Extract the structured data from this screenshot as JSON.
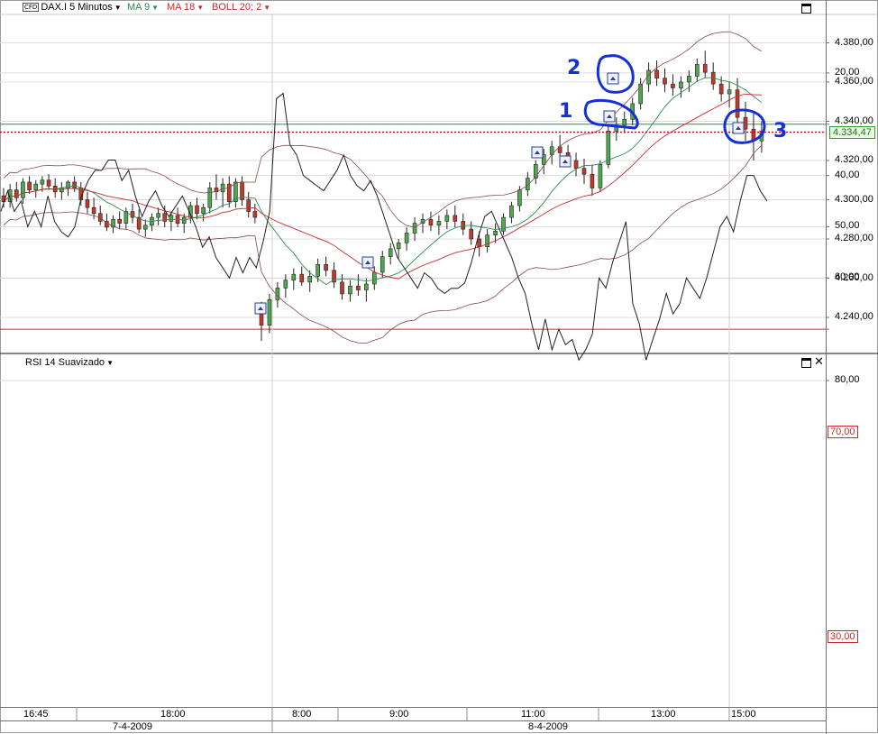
{
  "toolbar": {
    "instrument": "DAX.I 5 Minutos",
    "instrument_badge": "CFD",
    "ma9": "MA 9",
    "ma18": "MA 18",
    "boll": "BOLL 20; 2"
  },
  "rsi_panel": {
    "title": "RSI 14 Suavizado"
  },
  "price_tag": "4.334,47",
  "rsi_ref_tags": [
    "70,00",
    "30,00"
  ],
  "annotations": [
    "1",
    "2",
    "3"
  ],
  "colors": {
    "ma9": "#2e8b57",
    "ma18": "#cc2b2b",
    "boll": "#8b4a4a",
    "current": "#cc0000",
    "annotation": "#1530d8"
  },
  "chart_data": [
    {
      "type": "candlestick",
      "title": "DAX.I 5 Minutos",
      "ylim": [
        4225,
        4400
      ],
      "yticks": [
        "4.240,00",
        "4.260,00",
        "4.280,00",
        "4.300,00",
        "4.320,00",
        "4.340,00",
        "4.360,00",
        "4.380,00"
      ],
      "ytick_values": [
        4240,
        4260,
        4280,
        4300,
        4320,
        4340,
        4360,
        4380
      ],
      "current_price": 4334.47,
      "series": [
        {
          "name": "DAX.I",
          "description": "5-minute candles (open, high, low, close), approximate",
          "ohlc": [
            [
              4302,
              4306,
              4296,
              4299
            ],
            [
              4299,
              4308,
              4296,
              4305
            ],
            [
              4305,
              4309,
              4299,
              4301
            ],
            [
              4301,
              4311,
              4298,
              4309
            ],
            [
              4309,
              4312,
              4303,
              4305
            ],
            [
              4305,
              4310,
              4301,
              4308
            ],
            [
              4308,
              4312,
              4304,
              4310
            ],
            [
              4310,
              4313,
              4305,
              4307
            ],
            [
              4307,
              4311,
              4301,
              4304
            ],
            [
              4304,
              4309,
              4300,
              4306
            ],
            [
              4306,
              4310,
              4302,
              4309
            ],
            [
              4309,
              4312,
              4304,
              4306
            ],
            [
              4306,
              4309,
              4297,
              4300
            ],
            [
              4300,
              4304,
              4293,
              4296
            ],
            [
              4296,
              4301,
              4290,
              4293
            ],
            [
              4293,
              4297,
              4287,
              4289
            ],
            [
              4289,
              4293,
              4284,
              4286
            ],
            [
              4286,
              4292,
              4283,
              4290
            ],
            [
              4290,
              4294,
              4285,
              4288
            ],
            [
              4288,
              4296,
              4285,
              4294
            ],
            [
              4294,
              4298,
              4288,
              4291
            ],
            [
              4291,
              4295,
              4283,
              4285
            ],
            [
              4285,
              4290,
              4281,
              4287
            ],
            [
              4287,
              4293,
              4284,
              4291
            ],
            [
              4291,
              4296,
              4287,
              4293
            ],
            [
              4293,
              4297,
              4286,
              4289
            ],
            [
              4289,
              4294,
              4284,
              4292
            ],
            [
              4292,
              4296,
              4286,
              4288
            ],
            [
              4288,
              4293,
              4283,
              4291
            ],
            [
              4291,
              4299,
              4288,
              4297
            ],
            [
              4297,
              4301,
              4290,
              4293
            ],
            [
              4293,
              4298,
              4289,
              4296
            ],
            [
              4296,
              4309,
              4293,
              4306
            ],
            [
              4306,
              4313,
              4300,
              4304
            ],
            [
              4304,
              4311,
              4296,
              4308
            ],
            [
              4308,
              4312,
              4296,
              4299
            ],
            [
              4299,
              4311,
              4296,
              4309
            ],
            [
              4309,
              4312,
              4297,
              4300
            ],
            [
              4300,
              4304,
              4291,
              4294
            ],
            [
              4294,
              4298,
              4288,
              4291
            ]
          ]
        },
        {
          "name": "DAX.I 8-4-2009",
          "description": "5-minute candles (open, high, low, close), approximate",
          "ohlc": [
            [
              4244,
              4248,
              4228,
              4236
            ],
            [
              4236,
              4252,
              4232,
              4249
            ],
            [
              4249,
              4258,
              4245,
              4255
            ],
            [
              4255,
              4262,
              4250,
              4259
            ],
            [
              4259,
              4265,
              4254,
              4262
            ],
            [
              4262,
              4266,
              4256,
              4258
            ],
            [
              4258,
              4264,
              4253,
              4261
            ],
            [
              4261,
              4270,
              4258,
              4267
            ],
            [
              4267,
              4271,
              4261,
              4264
            ],
            [
              4264,
              4268,
              4255,
              4258
            ],
            [
              4258,
              4262,
              4249,
              4252
            ],
            [
              4252,
              4259,
              4248,
              4256
            ],
            [
              4256,
              4262,
              4251,
              4254
            ],
            [
              4254,
              4260,
              4248,
              4257
            ],
            [
              4257,
              4266,
              4254,
              4263
            ],
            [
              4263,
              4274,
              4260,
              4271
            ],
            [
              4271,
              4278,
              4267,
              4275
            ],
            [
              4275,
              4280,
              4270,
              4278
            ],
            [
              4278,
              4286,
              4274,
              4283
            ],
            [
              4283,
              4291,
              4279,
              4288
            ],
            [
              4288,
              4293,
              4283,
              4290
            ],
            [
              4290,
              4294,
              4284,
              4287
            ],
            [
              4287,
              4292,
              4282,
              4289
            ],
            [
              4289,
              4295,
              4285,
              4292
            ],
            [
              4292,
              4297,
              4286,
              4289
            ],
            [
              4289,
              4293,
              4282,
              4285
            ],
            [
              4285,
              4289,
              4277,
              4280
            ],
            [
              4280,
              4284,
              4271,
              4276
            ],
            [
              4276,
              4285,
              4273,
              4282
            ],
            [
              4282,
              4288,
              4278,
              4284
            ],
            [
              4284,
              4293,
              4282,
              4291
            ],
            [
              4291,
              4299,
              4288,
              4297
            ],
            [
              4297,
              4307,
              4294,
              4305
            ],
            [
              4305,
              4314,
              4302,
              4311
            ],
            [
              4311,
              4320,
              4308,
              4318
            ],
            [
              4318,
              4326,
              4313,
              4323
            ],
            [
              4323,
              4330,
              4318,
              4327
            ],
            [
              4327,
              4333,
              4321,
              4324
            ],
            [
              4324,
              4328,
              4317,
              4320
            ],
            [
              4320,
              4324,
              4312,
              4316
            ],
            [
              4316,
              4321,
              4308,
              4313
            ],
            [
              4313,
              4318,
              4302,
              4306
            ],
            [
              4306,
              4320,
              4304,
              4318
            ],
            [
              4318,
              4338,
              4316,
              4335
            ],
            [
              4335,
              4342,
              4330,
              4338
            ],
            [
              4338,
              4345,
              4334,
              4341
            ],
            [
              4341,
              4352,
              4338,
              4349
            ],
            [
              4349,
              4362,
              4346,
              4359
            ],
            [
              4359,
              4370,
              4355,
              4366
            ],
            [
              4366,
              4371,
              4358,
              4362
            ],
            [
              4362,
              4367,
              4355,
              4359
            ],
            [
              4359,
              4364,
              4353,
              4357
            ],
            [
              4357,
              4363,
              4352,
              4360
            ],
            [
              4360,
              4366,
              4355,
              4363
            ],
            [
              4363,
              4372,
              4360,
              4369
            ],
            [
              4369,
              4376,
              4362,
              4365
            ],
            [
              4365,
              4370,
              4356,
              4359
            ],
            [
              4359,
              4363,
              4350,
              4354
            ],
            [
              4354,
              4360,
              4347,
              4356
            ],
            [
              4356,
              4362,
              4338,
              4342
            ],
            [
              4342,
              4350,
              4330,
              4336
            ],
            [
              4336,
              4345,
              4320,
              4330
            ],
            [
              4330,
              4340,
              4324,
              4335
            ]
          ]
        }
      ],
      "indicators": [
        {
          "name": "MA 9",
          "color": "#2e8b57",
          "type": "line"
        },
        {
          "name": "MA 18",
          "color": "#cc2b2b",
          "type": "line"
        },
        {
          "name": "BOLL 20; 2",
          "color": "#8b4a4a",
          "type": "band"
        }
      ]
    },
    {
      "type": "line",
      "title": "RSI 14 Suavizado",
      "ylim": [
        15,
        85
      ],
      "yticks": [
        "20,00",
        "40,00",
        "50,00",
        "60,00",
        "70,00",
        "80,00",
        "30,00"
      ],
      "ytick_values": [
        20,
        40,
        50,
        60,
        70,
        80,
        30
      ],
      "reference_lines": [
        {
          "value": 70,
          "color": "#cc2b2b"
        },
        {
          "value": 30,
          "color": "#2e8b57"
        }
      ],
      "series": [
        {
          "name": "RSI",
          "values": [
            47,
            43,
            47,
            45,
            50,
            47,
            50,
            44,
            49,
            51,
            52,
            50,
            44,
            41,
            39,
            39,
            37,
            37,
            41,
            39,
            44,
            48,
            45,
            43,
            46,
            48,
            46,
            44,
            47,
            50,
            54,
            52,
            56,
            58,
            60,
            56,
            59,
            56,
            58,
            53,
            47,
            25,
            24,
            34,
            36,
            40,
            41,
            42,
            43,
            41,
            39,
            36,
            40,
            42,
            43,
            41,
            44,
            48,
            52,
            56,
            58,
            60,
            62,
            59,
            60,
            62,
            63,
            62,
            62,
            61,
            57,
            52,
            48,
            47,
            50,
            53,
            56,
            60,
            63,
            69,
            74,
            68,
            74,
            70,
            73,
            72,
            76,
            74,
            71,
            60,
            62,
            57,
            53,
            49,
            65,
            69,
            76,
            72,
            68,
            63,
            67,
            65,
            60,
            62,
            64,
            60,
            55,
            50,
            48,
            51,
            45,
            40,
            40,
            43,
            45
          ]
        }
      ],
      "x_axis": {
        "labels": [
          "16:45",
          "18:00",
          "8:00",
          "9:00",
          "11:00",
          "13:00",
          "15:00"
        ],
        "dates": [
          "7-4-2009",
          "8-4-2009"
        ]
      }
    }
  ]
}
